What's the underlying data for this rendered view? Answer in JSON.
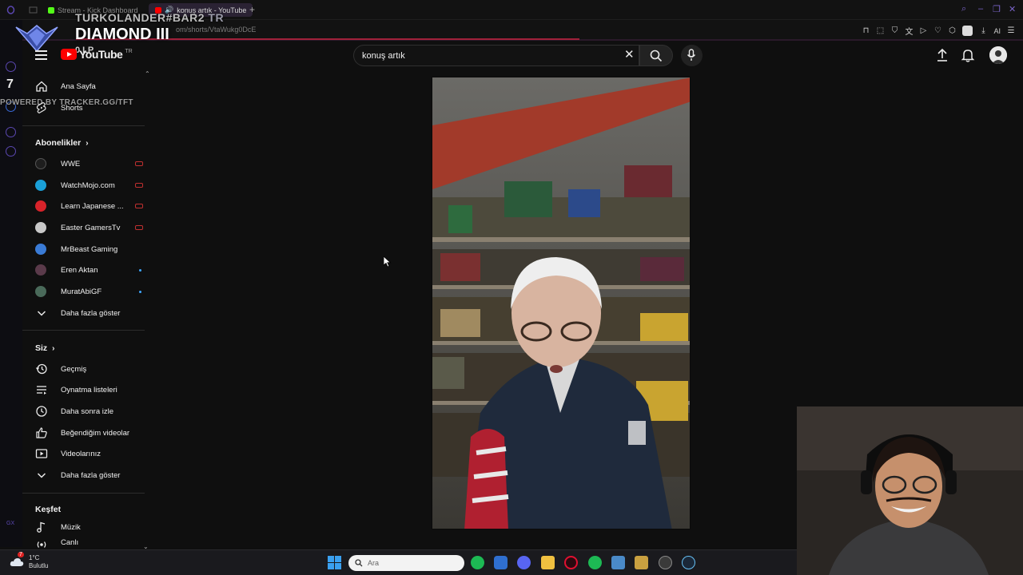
{
  "browser": {
    "tabs": [
      {
        "label": "Stream - Kick Dashboard",
        "active": false,
        "favicon_color": "#53fc18"
      },
      {
        "label": "konuş artık - YouTube",
        "active": true,
        "favicon_color": "#ff0000"
      }
    ],
    "url_fragment": "om/shorts/VtaWukg0DcE",
    "ai_label": "AI"
  },
  "overlay": {
    "summoner": "TURKOLANDER#BAR2",
    "region": "TR",
    "rank": "DIAMOND III",
    "lp": "0 LP",
    "powered_by": "POWERED BY TRACKER.GG/TFT",
    "side_number": "7"
  },
  "youtube": {
    "logo_text": "YouTube",
    "logo_region": "TR",
    "search": {
      "value": "konuş artık",
      "placeholder": "Ara"
    },
    "guide": {
      "main": [
        {
          "label": "Ana Sayfa",
          "icon": "home-icon"
        },
        {
          "label": "Shorts",
          "icon": "shorts-icon"
        }
      ],
      "subscriptions_title": "Abonelikler",
      "subscriptions": [
        {
          "label": "WWE",
          "status": "live",
          "avatar_color": "#222222"
        },
        {
          "label": "WatchMojo.com",
          "status": "live",
          "avatar_color": "#1aa0d8"
        },
        {
          "label": "Learn Japanese ...",
          "status": "live",
          "avatar_color": "#d8232a"
        },
        {
          "label": "Easter GamersTv",
          "status": "live",
          "avatar_color": "#c8c8c8"
        },
        {
          "label": "MrBeast Gaming",
          "status": "none",
          "avatar_color": "#3a7bd5"
        },
        {
          "label": "Eren Aktan",
          "status": "new",
          "avatar_color": "#5a3a4a"
        },
        {
          "label": "MuratAbiGF",
          "status": "new",
          "avatar_color": "#4a6a5a"
        }
      ],
      "show_more": "Daha fazla göster",
      "you_title": "Siz",
      "you_items": [
        {
          "label": "Geçmiş",
          "icon": "history-icon"
        },
        {
          "label": "Oynatma listeleri",
          "icon": "playlists-icon"
        },
        {
          "label": "Daha sonra izle",
          "icon": "watch-later-icon"
        },
        {
          "label": "Beğendiğim videolar",
          "icon": "liked-videos-icon"
        },
        {
          "label": "Videolarınız",
          "icon": "your-videos-icon"
        }
      ],
      "you_show_more": "Daha fazla göster",
      "explore_title": "Keşfet",
      "explore_items": [
        {
          "label": "Müzik",
          "icon": "music-icon"
        },
        {
          "label": "Canlı",
          "icon": "live-icon"
        }
      ]
    }
  },
  "taskbar": {
    "temperature": "1°C",
    "weather_text": "Bulutlu",
    "weather_badge": "7",
    "search_placeholder": "Ara"
  }
}
